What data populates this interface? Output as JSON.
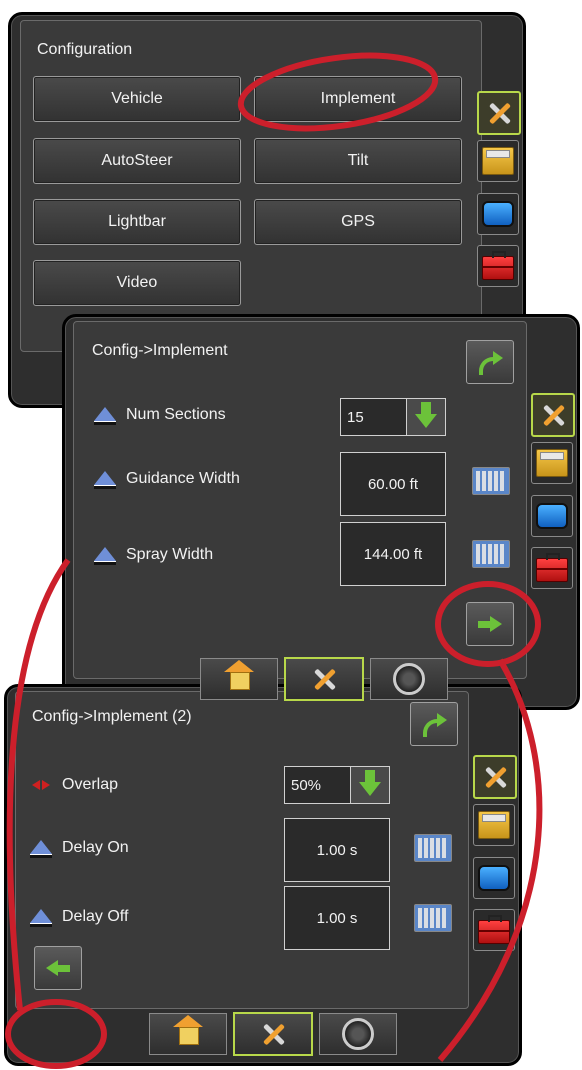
{
  "panel1": {
    "title": "Configuration",
    "buttons": [
      "Vehicle",
      "Implement",
      "AutoSteer",
      "Tilt",
      "Lightbar",
      "GPS",
      "Video"
    ]
  },
  "panel2": {
    "title": "Config->Implement",
    "rows": [
      {
        "label": "Num Sections",
        "value": "15"
      },
      {
        "label": "Guidance Width",
        "value": "60.00 ft"
      },
      {
        "label": "Spray Width",
        "value": "144.00 ft"
      }
    ]
  },
  "panel3": {
    "title": "Config->Implement (2)",
    "rows": [
      {
        "label": "Overlap",
        "value": "50%"
      },
      {
        "label": "Delay On",
        "value": "1.00 s"
      },
      {
        "label": "Delay Off",
        "value": "1.00 s"
      }
    ]
  },
  "side_tabs": [
    "tools-icon",
    "storage-icon",
    "monitor-icon",
    "toolbox-icon"
  ],
  "bottom_tabs": [
    "home-icon",
    "tools-icon",
    "gauge-icon"
  ],
  "colors": {
    "highlight": "#cc1f2b",
    "accent": "#b8d84a",
    "arrow": "#6cc23a"
  }
}
